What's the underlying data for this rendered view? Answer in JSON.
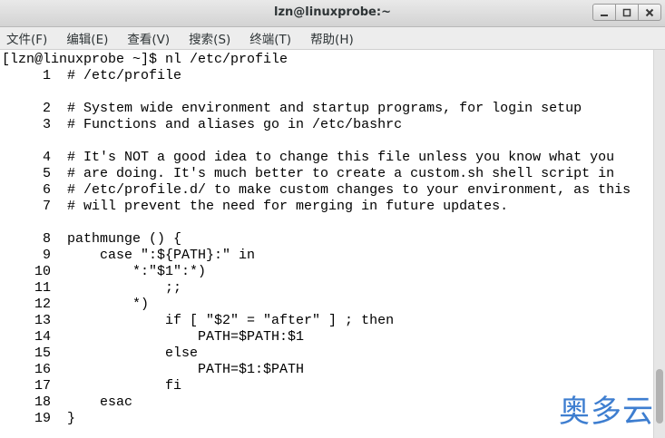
{
  "window": {
    "title": "lzn@linuxprobe:~"
  },
  "window_buttons": {
    "minimize": "–",
    "maximize": "□",
    "close": "×"
  },
  "menu": {
    "items": [
      {
        "label": "文件(F)"
      },
      {
        "label": "编辑(E)"
      },
      {
        "label": "查看(V)"
      },
      {
        "label": "搜索(S)"
      },
      {
        "label": "终端(T)"
      },
      {
        "label": "帮助(H)"
      }
    ]
  },
  "terminal": {
    "lines": [
      "[lzn@linuxprobe ~]$ nl /etc/profile",
      "     1  # /etc/profile",
      "",
      "     2  # System wide environment and startup programs, for login setup",
      "     3  # Functions and aliases go in /etc/bashrc",
      "",
      "     4  # It's NOT a good idea to change this file unless you know what you",
      "     5  # are doing. It's much better to create a custom.sh shell script in",
      "     6  # /etc/profile.d/ to make custom changes to your environment, as this",
      "     7  # will prevent the need for merging in future updates.",
      "",
      "     8  pathmunge () {",
      "     9      case \":${PATH}:\" in",
      "    10          *:\"$1\":*)",
      "    11              ;;",
      "    12          *)",
      "    13              if [ \"$2\" = \"after\" ] ; then",
      "    14                  PATH=$PATH:$1",
      "    15              else",
      "    16                  PATH=$1:$PATH",
      "    17              fi",
      "    18      esac",
      "    19  }"
    ]
  },
  "watermark": {
    "text": "奥多云"
  },
  "colors": {
    "titlebar": "#dcdcdc",
    "menubar": "#ededed",
    "terminal_bg": "#ffffff",
    "terminal_fg": "#000000",
    "watermark": "#3e7ed0"
  }
}
